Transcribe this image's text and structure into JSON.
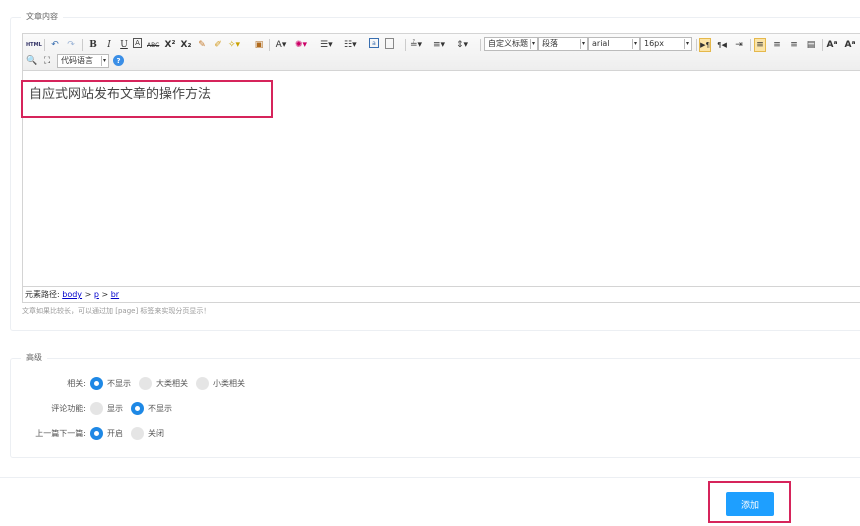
{
  "article_section": {
    "legend": "文章内容",
    "hint": "文章如果比较长，可以通过加 [page] 标签来实现分页显示！"
  },
  "editor": {
    "toolbar": {
      "html_label": "HTML",
      "bold": "B",
      "italic": "I",
      "underline": "U",
      "font_border": "A",
      "strike": "ABC",
      "superscript": "X²",
      "subscript": "X₂",
      "font_color": "A",
      "custom_heading": "自定义标题",
      "paragraph": "段落",
      "font_family": "arial",
      "font_size": "16px",
      "code_language": "代码语言"
    },
    "content": "自应式网站发布文章的操作方法",
    "status": {
      "path_label": "元素路径:",
      "path_body": "body",
      "path_p": "p",
      "path_br": "br",
      "sep": ">"
    }
  },
  "advanced": {
    "legend": "高级",
    "related": {
      "label": "相关:",
      "options": [
        "不显示",
        "大类相关",
        "小类相关"
      ],
      "selected": 0
    },
    "comment": {
      "label": "评论功能:",
      "options": [
        "显示",
        "不显示"
      ],
      "selected": 1
    },
    "prevnext": {
      "label": "上一篇下一篇:",
      "options": [
        "开启",
        "关闭"
      ],
      "selected": 0
    }
  },
  "submit_label": "添加",
  "colors": {
    "primary": "#1e9fff",
    "radio_on": "#1e88e5",
    "highlight": "#d6245b"
  }
}
